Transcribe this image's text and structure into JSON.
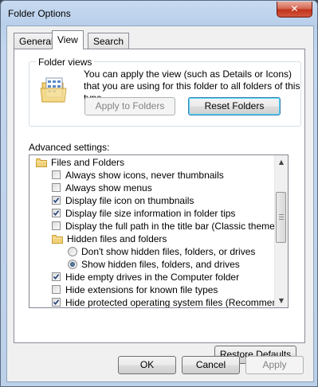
{
  "window": {
    "title": "Folder Options",
    "close_glyph": "✕"
  },
  "tabs": [
    {
      "label": "General",
      "active": false
    },
    {
      "label": "View",
      "active": true
    },
    {
      "label": "Search",
      "active": false
    }
  ],
  "folder_views": {
    "label": "Folder views",
    "description": "You can apply the view (such as Details or Icons) that you are using for this folder to all folders of this type.",
    "apply_button": "Apply to Folders",
    "reset_button": "Reset Folders",
    "icon": "folder-view-icon"
  },
  "advanced": {
    "label": "Advanced settings:",
    "items": [
      {
        "label": "Files and Folders",
        "kind": "folder"
      },
      {
        "label": "Always show icons, never thumbnails",
        "kind": "checkbox",
        "checked": false
      },
      {
        "label": "Always show menus",
        "kind": "checkbox",
        "checked": false
      },
      {
        "label": "Display file icon on thumbnails",
        "kind": "checkbox",
        "checked": true
      },
      {
        "label": "Display file size information in folder tips",
        "kind": "checkbox",
        "checked": true
      },
      {
        "label": "Display the full path in the title bar (Classic theme only)",
        "kind": "checkbox",
        "checked": false
      },
      {
        "label": "Hidden files and folders",
        "kind": "folder"
      },
      {
        "label": "Don't show hidden files, folders, or drives",
        "kind": "radio",
        "checked": false
      },
      {
        "label": "Show hidden files, folders, and drives",
        "kind": "radio",
        "checked": true
      },
      {
        "label": "Hide empty drives in the Computer folder",
        "kind": "checkbox",
        "checked": true
      },
      {
        "label": "Hide extensions for known file types",
        "kind": "checkbox",
        "checked": false
      },
      {
        "label": "Hide protected operating system files (Recommended)",
        "kind": "checkbox",
        "checked": true
      }
    ],
    "restore_button": "Restore Defaults"
  },
  "footer": {
    "ok": "OK",
    "cancel": "Cancel",
    "apply": "Apply"
  },
  "scrollbar": {
    "up_glyph": "▲",
    "down_glyph": "▼"
  },
  "colors": {
    "close_red": "#c2331c",
    "focus_blue": "#3c7fb1",
    "folder_yellow": "#e8c35a"
  }
}
